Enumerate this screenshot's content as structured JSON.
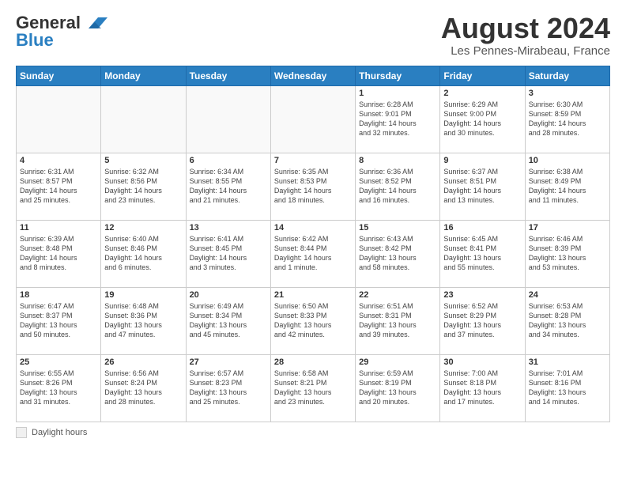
{
  "logo": {
    "line1": "General",
    "line2": "Blue"
  },
  "title": "August 2024",
  "subtitle": "Les Pennes-Mirabeau, France",
  "weekdays": [
    "Sunday",
    "Monday",
    "Tuesday",
    "Wednesday",
    "Thursday",
    "Friday",
    "Saturday"
  ],
  "legend_label": "Daylight hours",
  "weeks": [
    [
      {
        "day": "",
        "info": ""
      },
      {
        "day": "",
        "info": ""
      },
      {
        "day": "",
        "info": ""
      },
      {
        "day": "",
        "info": ""
      },
      {
        "day": "1",
        "info": "Sunrise: 6:28 AM\nSunset: 9:01 PM\nDaylight: 14 hours\nand 32 minutes."
      },
      {
        "day": "2",
        "info": "Sunrise: 6:29 AM\nSunset: 9:00 PM\nDaylight: 14 hours\nand 30 minutes."
      },
      {
        "day": "3",
        "info": "Sunrise: 6:30 AM\nSunset: 8:59 PM\nDaylight: 14 hours\nand 28 minutes."
      }
    ],
    [
      {
        "day": "4",
        "info": "Sunrise: 6:31 AM\nSunset: 8:57 PM\nDaylight: 14 hours\nand 25 minutes."
      },
      {
        "day": "5",
        "info": "Sunrise: 6:32 AM\nSunset: 8:56 PM\nDaylight: 14 hours\nand 23 minutes."
      },
      {
        "day": "6",
        "info": "Sunrise: 6:34 AM\nSunset: 8:55 PM\nDaylight: 14 hours\nand 21 minutes."
      },
      {
        "day": "7",
        "info": "Sunrise: 6:35 AM\nSunset: 8:53 PM\nDaylight: 14 hours\nand 18 minutes."
      },
      {
        "day": "8",
        "info": "Sunrise: 6:36 AM\nSunset: 8:52 PM\nDaylight: 14 hours\nand 16 minutes."
      },
      {
        "day": "9",
        "info": "Sunrise: 6:37 AM\nSunset: 8:51 PM\nDaylight: 14 hours\nand 13 minutes."
      },
      {
        "day": "10",
        "info": "Sunrise: 6:38 AM\nSunset: 8:49 PM\nDaylight: 14 hours\nand 11 minutes."
      }
    ],
    [
      {
        "day": "11",
        "info": "Sunrise: 6:39 AM\nSunset: 8:48 PM\nDaylight: 14 hours\nand 8 minutes."
      },
      {
        "day": "12",
        "info": "Sunrise: 6:40 AM\nSunset: 8:46 PM\nDaylight: 14 hours\nand 6 minutes."
      },
      {
        "day": "13",
        "info": "Sunrise: 6:41 AM\nSunset: 8:45 PM\nDaylight: 14 hours\nand 3 minutes."
      },
      {
        "day": "14",
        "info": "Sunrise: 6:42 AM\nSunset: 8:44 PM\nDaylight: 14 hours\nand 1 minute."
      },
      {
        "day": "15",
        "info": "Sunrise: 6:43 AM\nSunset: 8:42 PM\nDaylight: 13 hours\nand 58 minutes."
      },
      {
        "day": "16",
        "info": "Sunrise: 6:45 AM\nSunset: 8:41 PM\nDaylight: 13 hours\nand 55 minutes."
      },
      {
        "day": "17",
        "info": "Sunrise: 6:46 AM\nSunset: 8:39 PM\nDaylight: 13 hours\nand 53 minutes."
      }
    ],
    [
      {
        "day": "18",
        "info": "Sunrise: 6:47 AM\nSunset: 8:37 PM\nDaylight: 13 hours\nand 50 minutes."
      },
      {
        "day": "19",
        "info": "Sunrise: 6:48 AM\nSunset: 8:36 PM\nDaylight: 13 hours\nand 47 minutes."
      },
      {
        "day": "20",
        "info": "Sunrise: 6:49 AM\nSunset: 8:34 PM\nDaylight: 13 hours\nand 45 minutes."
      },
      {
        "day": "21",
        "info": "Sunrise: 6:50 AM\nSunset: 8:33 PM\nDaylight: 13 hours\nand 42 minutes."
      },
      {
        "day": "22",
        "info": "Sunrise: 6:51 AM\nSunset: 8:31 PM\nDaylight: 13 hours\nand 39 minutes."
      },
      {
        "day": "23",
        "info": "Sunrise: 6:52 AM\nSunset: 8:29 PM\nDaylight: 13 hours\nand 37 minutes."
      },
      {
        "day": "24",
        "info": "Sunrise: 6:53 AM\nSunset: 8:28 PM\nDaylight: 13 hours\nand 34 minutes."
      }
    ],
    [
      {
        "day": "25",
        "info": "Sunrise: 6:55 AM\nSunset: 8:26 PM\nDaylight: 13 hours\nand 31 minutes."
      },
      {
        "day": "26",
        "info": "Sunrise: 6:56 AM\nSunset: 8:24 PM\nDaylight: 13 hours\nand 28 minutes."
      },
      {
        "day": "27",
        "info": "Sunrise: 6:57 AM\nSunset: 8:23 PM\nDaylight: 13 hours\nand 25 minutes."
      },
      {
        "day": "28",
        "info": "Sunrise: 6:58 AM\nSunset: 8:21 PM\nDaylight: 13 hours\nand 23 minutes."
      },
      {
        "day": "29",
        "info": "Sunrise: 6:59 AM\nSunset: 8:19 PM\nDaylight: 13 hours\nand 20 minutes."
      },
      {
        "day": "30",
        "info": "Sunrise: 7:00 AM\nSunset: 8:18 PM\nDaylight: 13 hours\nand 17 minutes."
      },
      {
        "day": "31",
        "info": "Sunrise: 7:01 AM\nSunset: 8:16 PM\nDaylight: 13 hours\nand 14 minutes."
      }
    ]
  ]
}
